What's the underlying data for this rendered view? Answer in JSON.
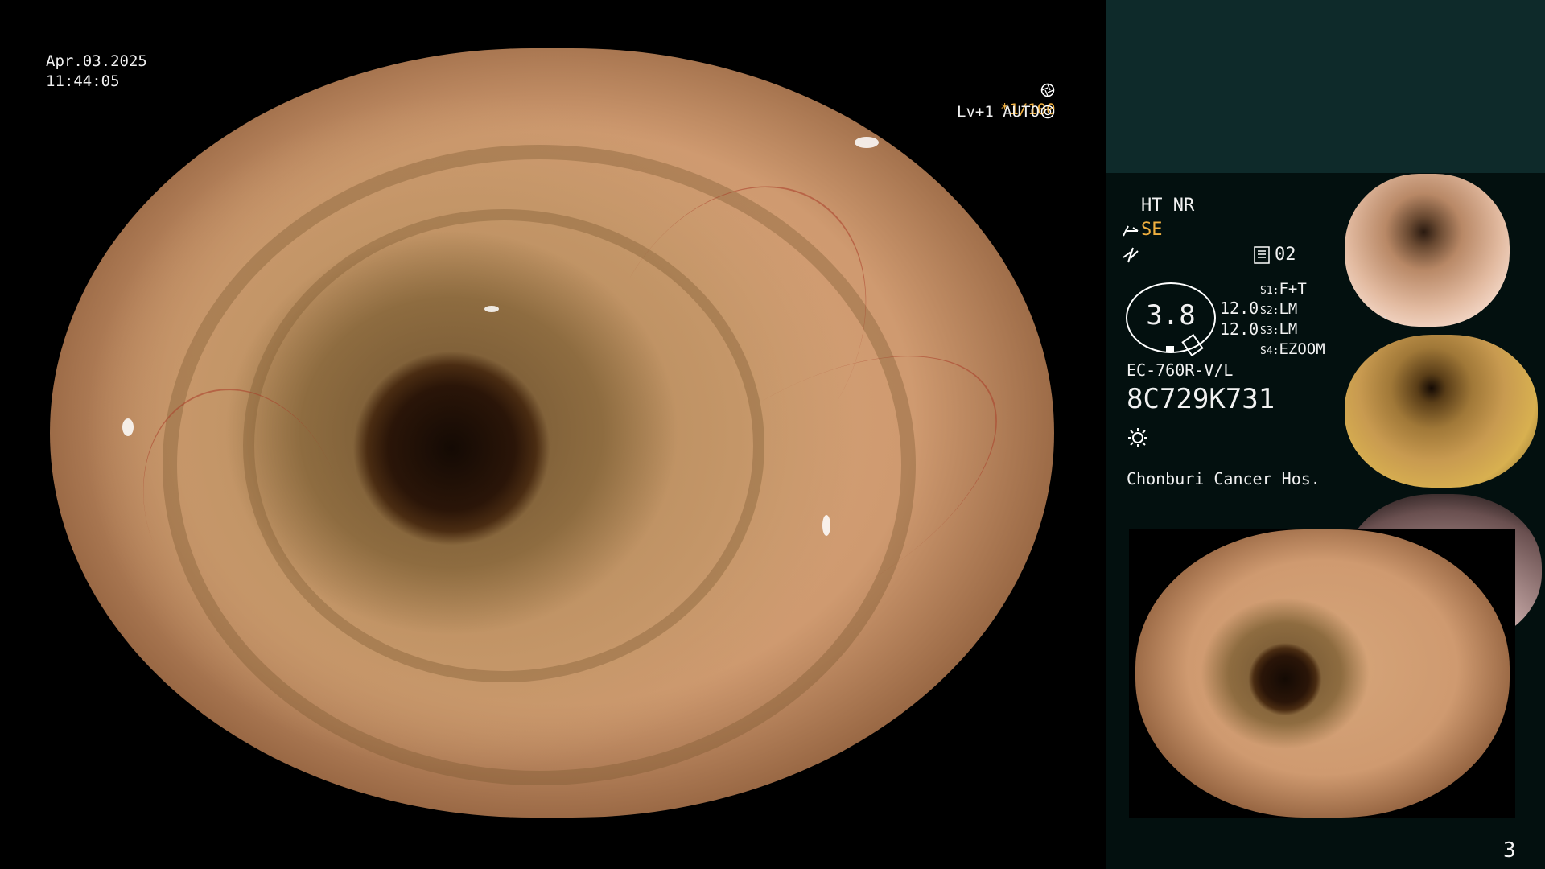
{
  "overlay": {
    "date": "Apr.03.2025",
    "time": "11:44:05",
    "zoom_ratio": "*1/100",
    "level": "Lv+1 AUTO"
  },
  "settings": {
    "ht_nr": "HT NR",
    "se": "SE",
    "preset": "02",
    "ring_value": "3.8",
    "value_1": "12.0",
    "value_2": "12.0",
    "switches": [
      {
        "key": "S1:",
        "value": "F+T"
      },
      {
        "key": "S2:",
        "value": "LM"
      },
      {
        "key": "S3:",
        "value": "LM"
      },
      {
        "key": "S4:",
        "value": "EZOOM"
      }
    ],
    "scope_model": "EC-760R-V/L",
    "serial": "8C729K731",
    "hospital": "Chonburi Cancer Hos."
  },
  "thumbnails": {
    "caption": "8C729K731"
  },
  "page_number": "3",
  "icons": [
    "aperture-icon",
    "target-icon",
    "pen-icon",
    "zigzag-icon",
    "memory-icon",
    "light-icon"
  ],
  "colors": {
    "accent": "#f0b040",
    "panel": "#03100f",
    "panel_top": "#0e2a2a"
  }
}
